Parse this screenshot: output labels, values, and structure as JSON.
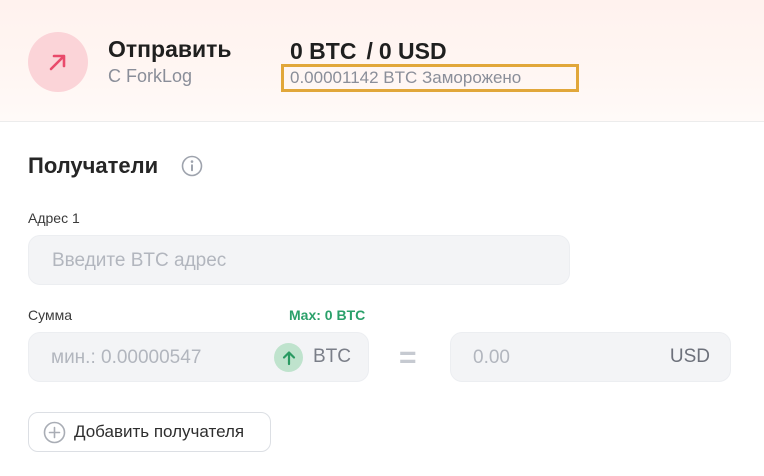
{
  "header": {
    "icon": "arrow-up-right-icon",
    "accent_color": "#e94a6b",
    "title": "Отправить",
    "subtitle": "С ForkLog",
    "balance_btc": "0 BTC",
    "balance_sep": "/",
    "balance_usd": "0 USD",
    "frozen": "0.00001142 BTC Заморожено"
  },
  "recipients": {
    "title": "Получатели",
    "info_icon": "info-icon",
    "address_label": "Адрес 1",
    "address_placeholder": "Введите BTC адрес",
    "amount_label": "Сумма",
    "max_text": "Max: 0 BTC",
    "max_color": "#2aa06a",
    "btc_placeholder": "мин.: 0.00000547",
    "btc_unit": "BTC",
    "swap_icon": "arrow-up-icon",
    "equals": "=",
    "usd_placeholder": "0.00",
    "usd_unit": "USD",
    "add_button": "Добавить получателя",
    "add_icon": "plus-circle-icon"
  }
}
